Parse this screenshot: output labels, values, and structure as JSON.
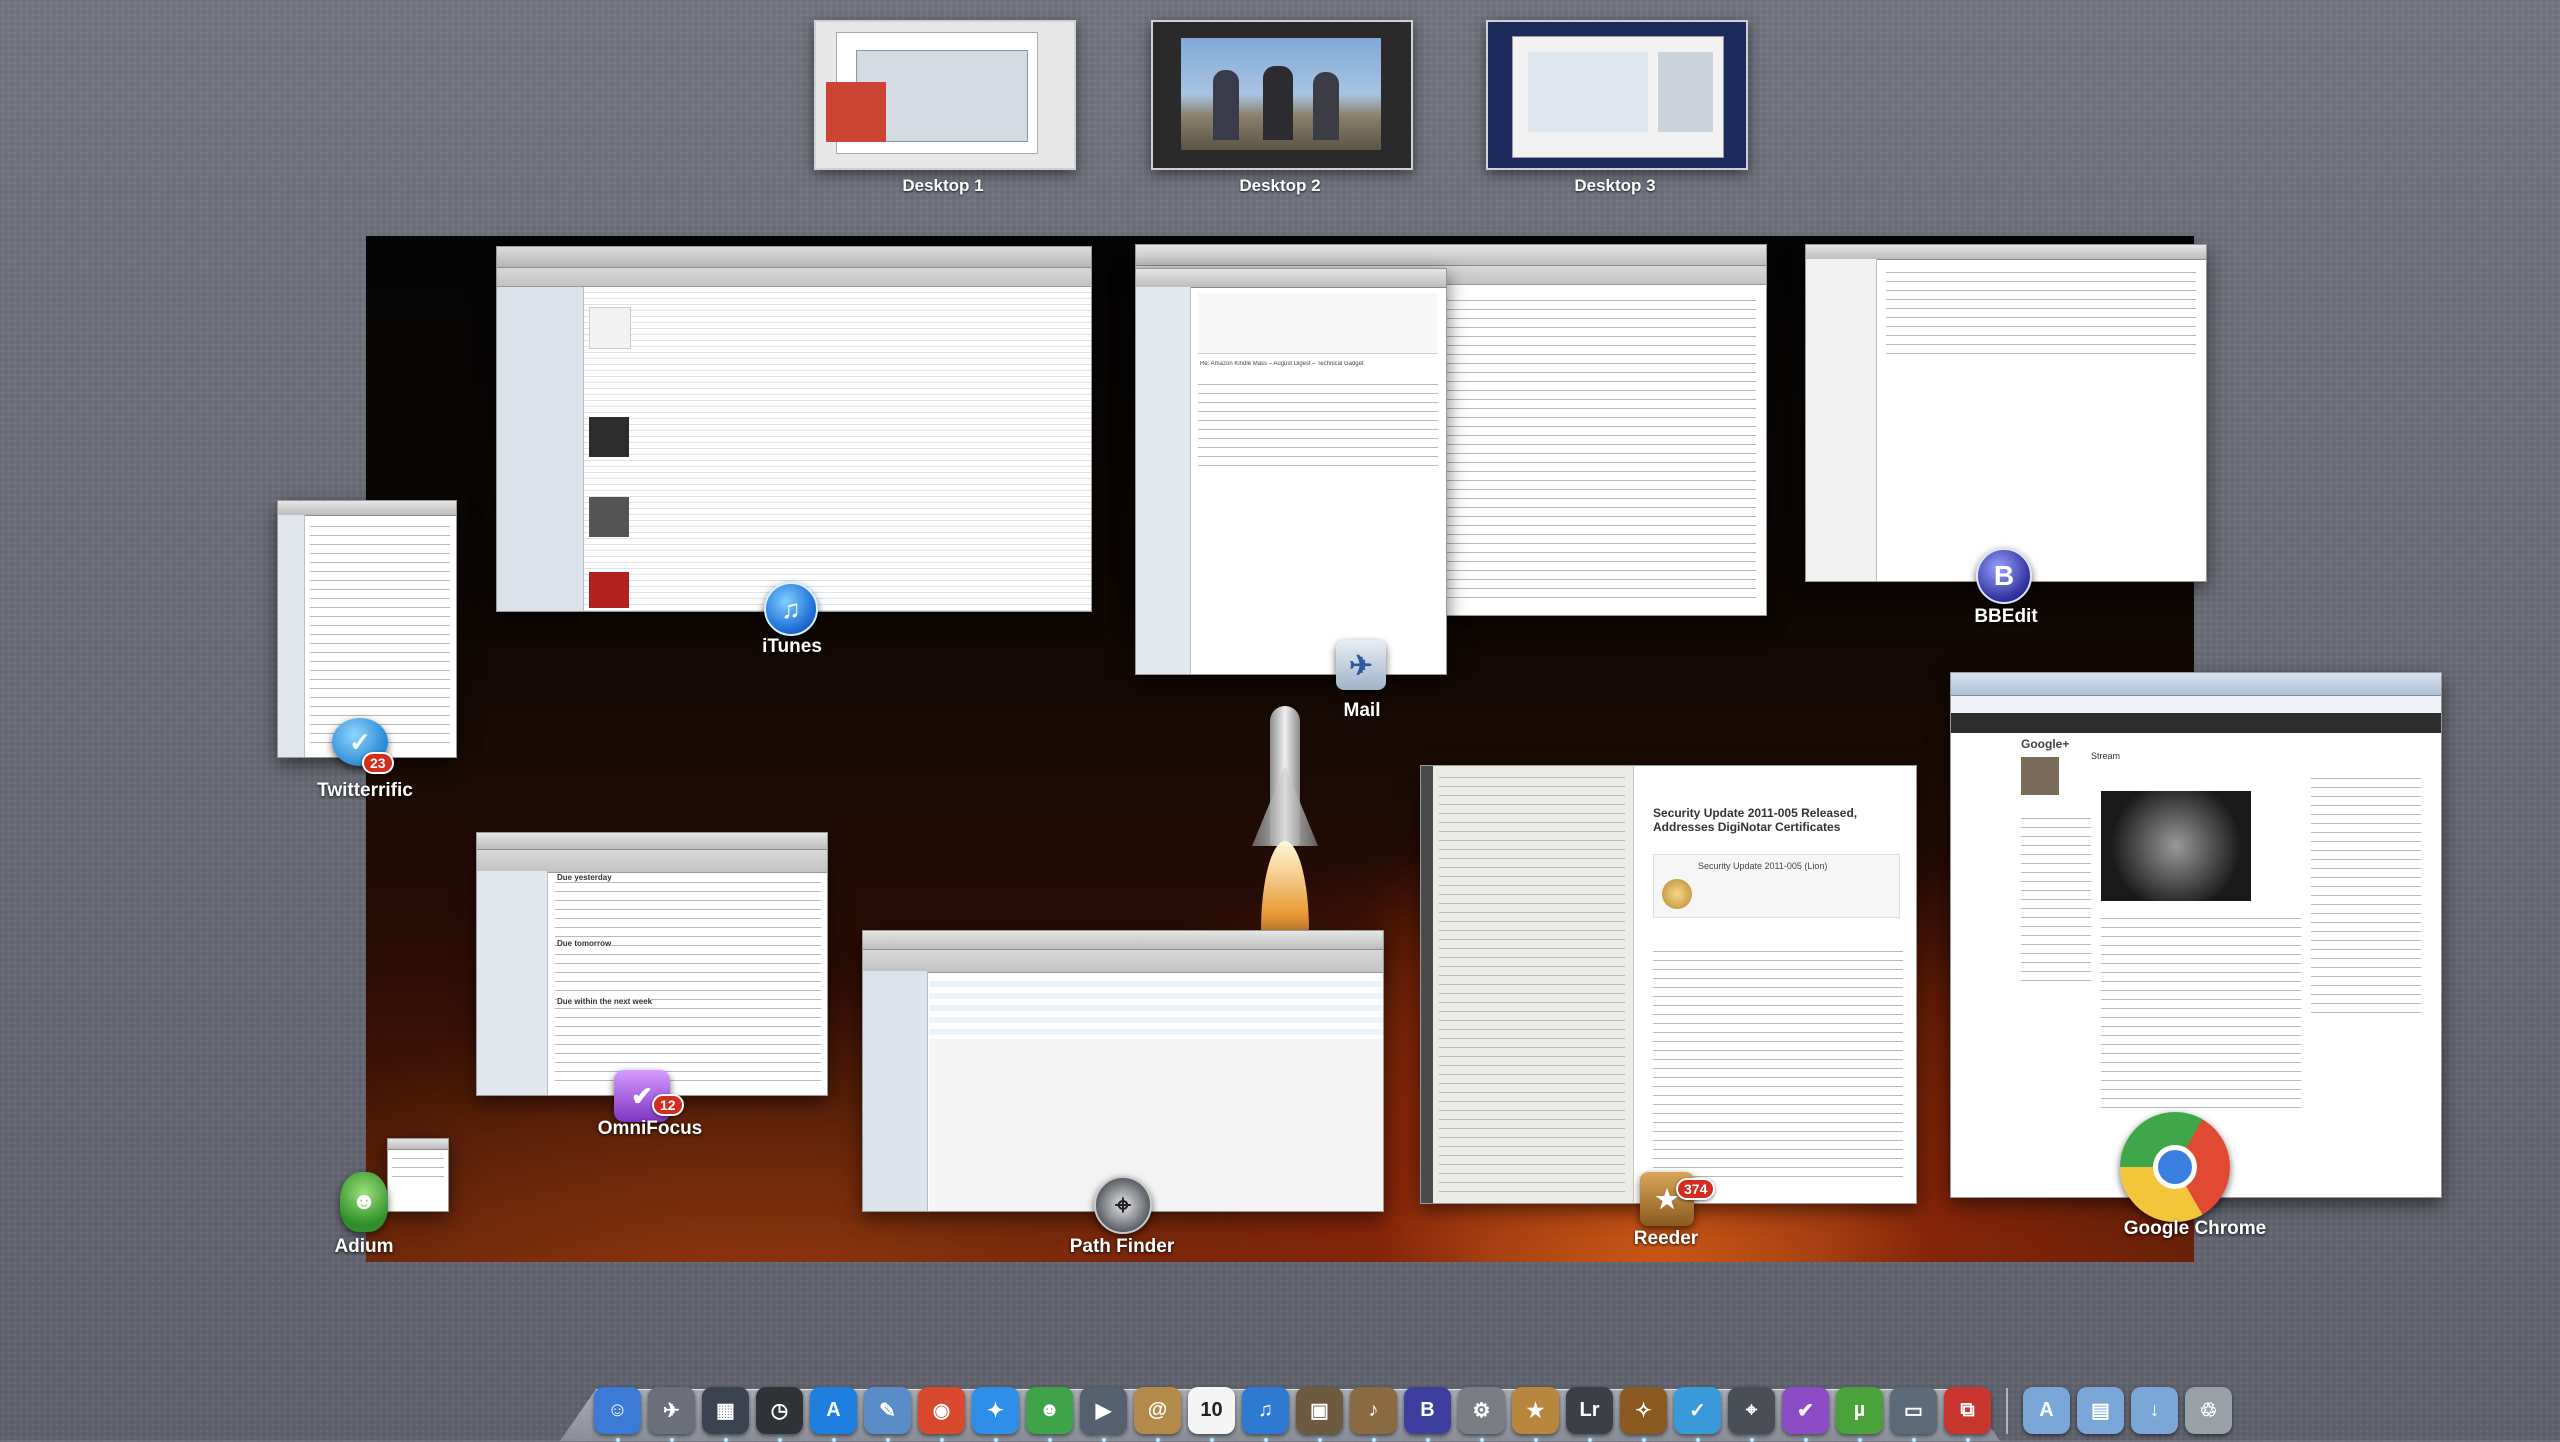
{
  "spaces": [
    {
      "label": "Desktop 1"
    },
    {
      "label": "Desktop 2"
    },
    {
      "label": "Desktop 3"
    }
  ],
  "apps": {
    "itunes": {
      "label": "iTunes"
    },
    "mail": {
      "label": "Mail"
    },
    "bbedit": {
      "label": "BBEdit"
    },
    "twitterrific": {
      "label": "Twitterrific",
      "badge": "23"
    },
    "omnifocus": {
      "label": "OmniFocus",
      "badge": "12"
    },
    "adium": {
      "label": "Adium"
    },
    "pathfinder": {
      "label": "Path Finder"
    },
    "reeder": {
      "label": "Reeder",
      "badge": "374"
    },
    "chrome": {
      "label": "Google Chrome"
    }
  },
  "reeder_article": {
    "title": "Security Update 2011-005 Released, Addresses DigiNotar Certificates",
    "update_name": "Security Update 2011-005 (Lion)"
  },
  "omnifocus_sections": {
    "s1": "Due yesterday",
    "s2": "Due tomorrow",
    "s3": "Due within the next week"
  },
  "chrome_window": {
    "brand": "Google+",
    "stream": "Stream"
  },
  "mail_window": {
    "subject": "Re: Amazon Kindle Mass – August Digest – Technical Gadget"
  },
  "dock": {
    "items": [
      {
        "name": "finder",
        "glyph": "☺",
        "color": "#3b7bd6"
      },
      {
        "name": "launchpad",
        "glyph": "✈",
        "color": "#6a6f7a"
      },
      {
        "name": "mission-control",
        "glyph": "▦",
        "color": "#3c4350"
      },
      {
        "name": "dashboard",
        "glyph": "◷",
        "color": "#2f3338"
      },
      {
        "name": "app-store",
        "glyph": "A",
        "color": "#1e7fe0"
      },
      {
        "name": "preview",
        "glyph": "✎",
        "color": "#5a8cc7"
      },
      {
        "name": "chrome",
        "glyph": "◉",
        "color": "#d9492e"
      },
      {
        "name": "safari",
        "glyph": "✦",
        "color": "#2f8fe8"
      },
      {
        "name": "adium",
        "glyph": "☻",
        "color": "#3fa34a"
      },
      {
        "name": "facetime",
        "glyph": "▶",
        "color": "#55606e"
      },
      {
        "name": "address-book",
        "glyph": "@",
        "color": "#b38a4a"
      },
      {
        "name": "ical",
        "glyph": "10",
        "color": "#f5f5f5"
      },
      {
        "name": "itunes",
        "glyph": "♫",
        "color": "#2e7ad1"
      },
      {
        "name": "iphoto",
        "glyph": "▣",
        "color": "#6d5a3f"
      },
      {
        "name": "garageband",
        "glyph": "♪",
        "color": "#8a6a40"
      },
      {
        "name": "bbedit",
        "glyph": "B",
        "color": "#3d3f9e"
      },
      {
        "name": "system-prefs",
        "glyph": "⚙",
        "color": "#7a7d84"
      },
      {
        "name": "reeder",
        "glyph": "★",
        "color": "#b8863d"
      },
      {
        "name": "lightroom",
        "glyph": "Lr",
        "color": "#3b4047"
      },
      {
        "name": "pixelmator",
        "glyph": "✧",
        "color": "#8a5a20"
      },
      {
        "name": "twitterrific",
        "glyph": "✓",
        "color": "#3a9ad9"
      },
      {
        "name": "path-finder",
        "glyph": "⌖",
        "color": "#4a4f57"
      },
      {
        "name": "omnifocus",
        "glyph": "✔",
        "color": "#8c4cc5"
      },
      {
        "name": "utorrent",
        "glyph": "µ",
        "color": "#4aa33a"
      },
      {
        "name": "disk-utility",
        "glyph": "▭",
        "color": "#5c6a7a"
      },
      {
        "name": "parallels",
        "glyph": "⧉",
        "color": "#c8352e"
      }
    ],
    "folders": [
      {
        "name": "applications-folder",
        "glyph": "A",
        "color": "#7aa6d8"
      },
      {
        "name": "documents-folder",
        "glyph": "▤",
        "color": "#7aa6d8"
      },
      {
        "name": "downloads-folder",
        "glyph": "↓",
        "color": "#7aa6d8"
      },
      {
        "name": "trash",
        "glyph": "♲",
        "color": "#9aa0a8"
      }
    ]
  }
}
